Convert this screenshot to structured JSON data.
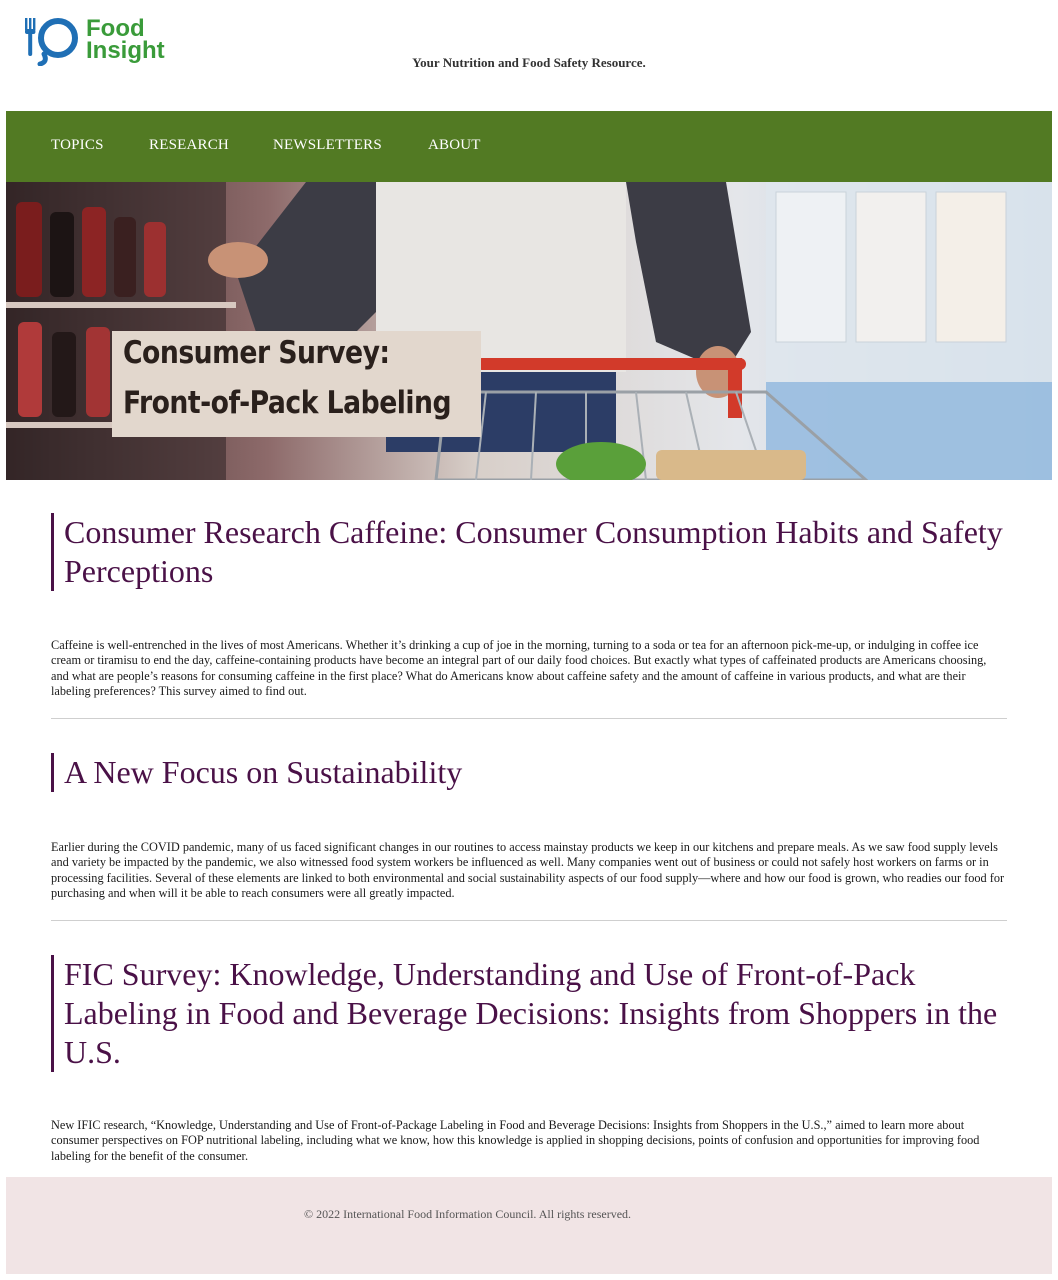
{
  "header": {
    "logo_line1": "Food",
    "logo_line2": "Insight",
    "tagline": "Your Nutrition and Food Safety Resource."
  },
  "nav": {
    "items": [
      {
        "label": "TOPICS"
      },
      {
        "label": "RESEARCH"
      },
      {
        "label": "NEWSLETTERS"
      },
      {
        "label": "ABOUT"
      }
    ]
  },
  "hero": {
    "caption_line1": "Consumer Survey:",
    "caption_line2": "Front-of-Pack Labeling"
  },
  "articles": [
    {
      "title": "Consumer Research Caffeine: Consumer Consumption Habits and Safety Perceptions",
      "body": "Caffeine is well-entrenched in the lives of most Americans. Whether it’s drinking a cup of joe in the morning, turning to a soda or tea for an afternoon pick-me-up, or indulging in coffee ice cream or tiramisu to end the day, caffeine-containing products have become an integral part of our daily food choices. But exactly what types of caffeinated products are Americans choosing, and what are people’s reasons for consuming caffeine in the first place? What do Americans know about caffeine safety and the amount of caffeine in various products, and what are their labeling preferences? This survey aimed to find out."
    },
    {
      "title": "A New Focus on Sustainability",
      "body": "Earlier during the COVID pandemic, many of us faced significant changes in our routines to access mainstay products we keep in our kitchens and prepare meals. As we saw food supply levels and variety be impacted by the pandemic, we also witnessed food system workers be influenced as well. Many companies went out of business or could not safely host workers on farms or in processing facilities. Several of these elements are linked to both environmental and social sustainability aspects of our food supply—where and how our food is grown, who readies our food for purchasing and when will it be able to reach consumers were all greatly impacted."
    },
    {
      "title": "FIC Survey: Knowledge, Understanding and Use of Front-of-Pack Labeling in Food and Beverage Decisions: Insights from Shoppers in the U.S.",
      "body": "New IFIC research, “Knowledge, Understanding and Use of Front-of-Package Labeling in Food and Beverage Decisions: Insights from Shoppers in the U.S.,” aimed to learn more about consumer perspectives on FOP nutritional labeling, including what we know, how this knowledge is applied in shopping decisions, points of confusion and opportunities for improving food labeling for the benefit of the consumer."
    }
  ],
  "footer": {
    "copyright": "© 2022 International Food Information Council. All rights reserved."
  },
  "colors": {
    "brand_green": "#527a23",
    "logo_blue": "#1f6fb5",
    "logo_green": "#3a9b3a",
    "heading_purple": "#4a1147",
    "footer_bg": "#f1e4e5"
  }
}
